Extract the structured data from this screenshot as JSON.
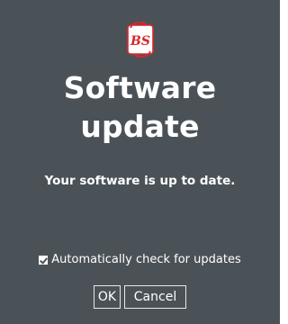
{
  "dialog": {
    "logo": {
      "text": "BS",
      "icon": "bs-logo-icon",
      "colors": {
        "primary": "#d8262e",
        "background": "#ffffff"
      }
    },
    "title": "Software update",
    "status": "Your software is up to date.",
    "auto_check": {
      "label": "Automatically check for updates",
      "checked": true
    },
    "buttons": {
      "ok": "OK",
      "cancel": "Cancel"
    }
  },
  "colors": {
    "dialog_background": "#4b5257",
    "text": "#ffffff"
  }
}
